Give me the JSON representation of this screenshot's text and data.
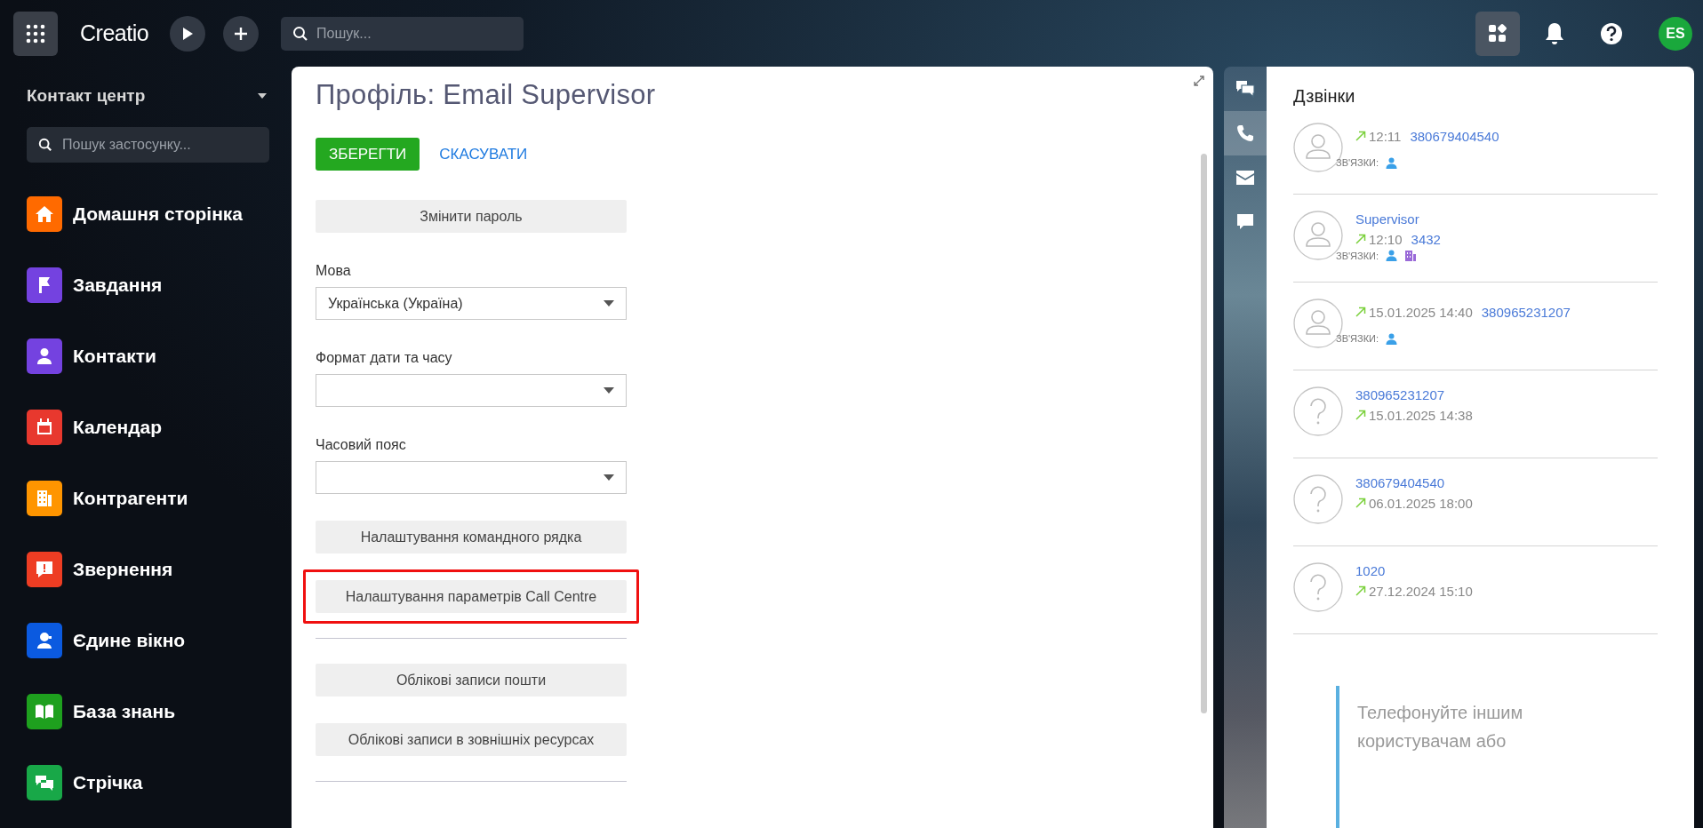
{
  "top_bar": {
    "logo": "Creatio",
    "search": {
      "placeholder": "Пошук..."
    },
    "avatar": "ES"
  },
  "sidebar": {
    "workplace": "Контакт центр",
    "search": {
      "placeholder": "Пошук застосунку..."
    },
    "items": [
      {
        "label": "Домашня сторінка",
        "color": "#ff6a00"
      },
      {
        "label": "Завдання",
        "color": "#7442e0"
      },
      {
        "label": "Контакти",
        "color": "#7442e0"
      },
      {
        "label": "Календар",
        "color": "#e8382e"
      },
      {
        "label": "Контрагенти",
        "color": "#ff9500"
      },
      {
        "label": "Звернення",
        "color": "#ee3d23"
      },
      {
        "label": "Єдине вікно",
        "color": "#0b5ae0"
      },
      {
        "label": "База знань",
        "color": "#1ea01e"
      },
      {
        "label": "Стрічка",
        "color": "#18a848"
      }
    ]
  },
  "profile": {
    "title": "Профіль: Email Supervisor",
    "save": "ЗБЕРЕГТИ",
    "cancel": "СКАСУВАТИ",
    "items": [
      {
        "kind": "button",
        "label": "Змінити пароль",
        "highlighted": false
      },
      {
        "kind": "select",
        "label": "Мова",
        "value": "Українська (Україна)"
      },
      {
        "kind": "select",
        "label": "Формат дати та часу"
      },
      {
        "kind": "select",
        "label": "Часовий пояс"
      },
      {
        "kind": "button",
        "label": "Налаштування командного рядка",
        "highlighted": false
      },
      {
        "kind": "button",
        "label": "Налаштування параметрів Call Centre",
        "highlighted": true
      },
      {
        "kind": "divider"
      },
      {
        "kind": "button",
        "label": "Облікові записи пошти",
        "highlighted": false
      },
      {
        "kind": "button",
        "label": "Облікові записи в зовнішніх ресурсах",
        "highlighted": false
      },
      {
        "kind": "divider"
      }
    ]
  },
  "communication_tabs": [
    {
      "selected": false
    },
    {
      "selected": true
    },
    {
      "selected": false
    },
    {
      "selected": false
    }
  ],
  "calls": {
    "title": "Дзвінки",
    "items": [
      {
        "kind": "contact",
        "time": "12:11",
        "number": "380679404540",
        "links_label": "ЗВ'ЯЗКИ:",
        "links": [
          {
            "kind": "contact"
          }
        ]
      },
      {
        "kind": "contact",
        "name": "Supervisor",
        "time": "12:10",
        "number": "3432",
        "links_label": "ЗВ'ЯЗКИ:",
        "links": [
          {
            "kind": "contact"
          },
          {
            "kind": "account"
          }
        ]
      },
      {
        "kind": "contact",
        "time": "15.01.2025 14:40",
        "number": "380965231207",
        "links_label": "ЗВ'ЯЗКИ:",
        "links": [
          {
            "kind": "contact"
          }
        ]
      },
      {
        "kind": "unknown",
        "number": "380965231207",
        "time": "15.01.2025 14:38"
      },
      {
        "kind": "unknown",
        "number": "380679404540",
        "time": "06.01.2025 18:00"
      },
      {
        "kind": "unknown",
        "number": "1020",
        "time": "27.12.2024 15:10"
      }
    ],
    "hint": [
      "Телефонуйте іншим",
      "користувачам або"
    ]
  }
}
